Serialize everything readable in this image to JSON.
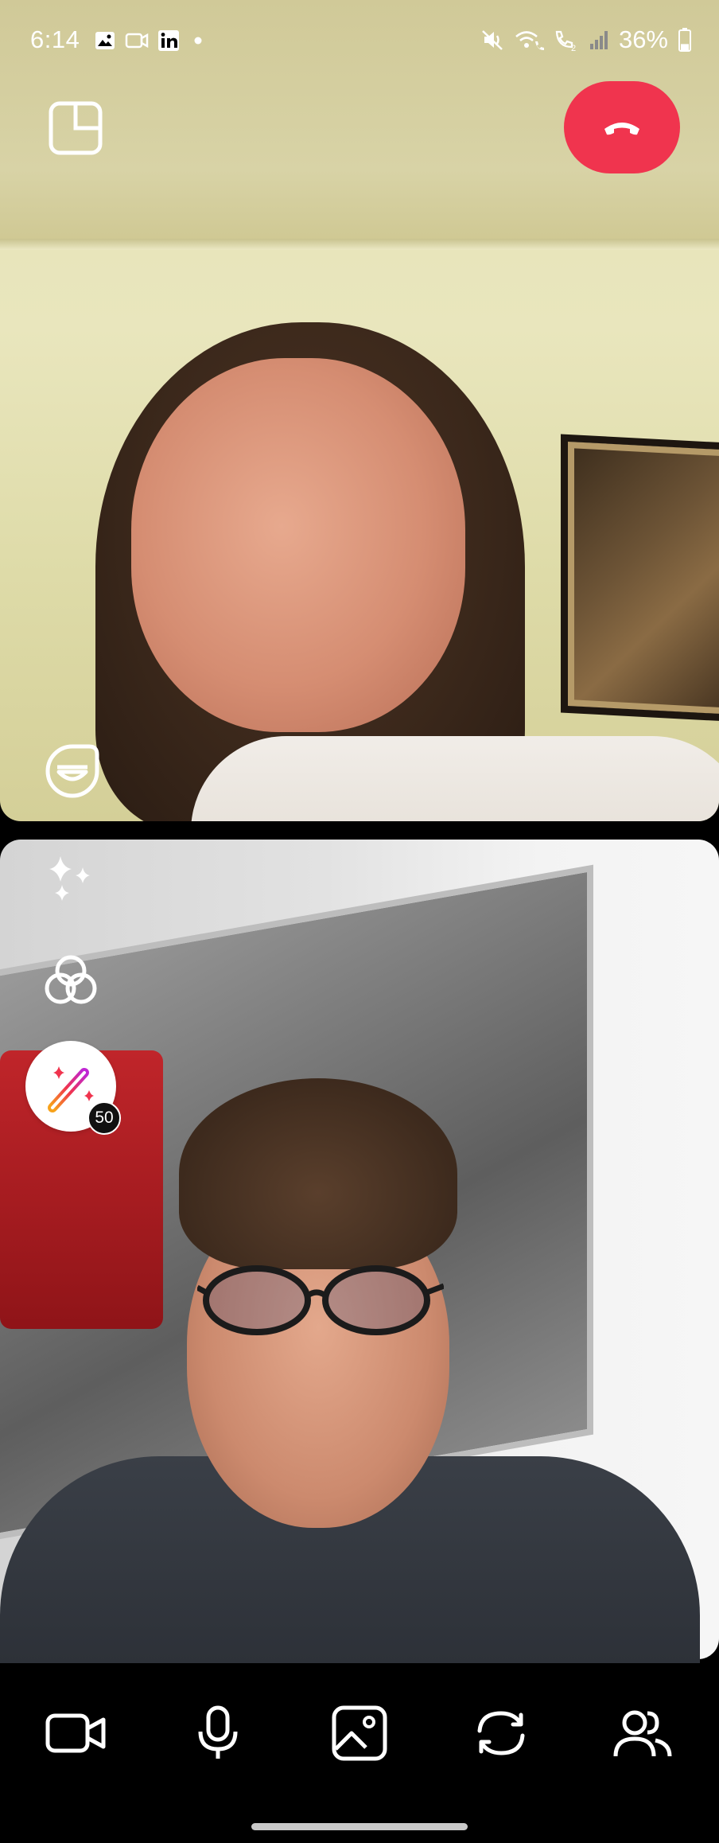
{
  "status_bar": {
    "time": "6:14",
    "left_icons": [
      "gallery-icon",
      "video-recorder-icon",
      "linkedin-icon",
      "dot-icon"
    ],
    "right_icons": [
      "mute-icon",
      "wifi-calling-icon",
      "call-sim-icon",
      "signal-icon"
    ],
    "sim_slot": "2",
    "battery_percent": "36%",
    "battery_level": 0.36
  },
  "call": {
    "remote_video": {
      "controls": [
        "picture-in-picture-icon",
        "end-call-icon",
        "emoji-reactions-icon"
      ]
    },
    "local_video": {
      "side_controls": [
        "sparkle-icon",
        "filter-icon",
        "magic-wand-icon"
      ],
      "effects_badge": "50"
    }
  },
  "toolbar": {
    "buttons": [
      {
        "icon": "video-camera-icon"
      },
      {
        "icon": "microphone-icon"
      },
      {
        "icon": "gallery-share-icon"
      },
      {
        "icon": "flip-camera-icon"
      },
      {
        "icon": "participants-icon"
      }
    ]
  },
  "colors": {
    "end_call": "#f0344e",
    "badge_bg": "#111111",
    "icon_white": "#ffffff"
  }
}
